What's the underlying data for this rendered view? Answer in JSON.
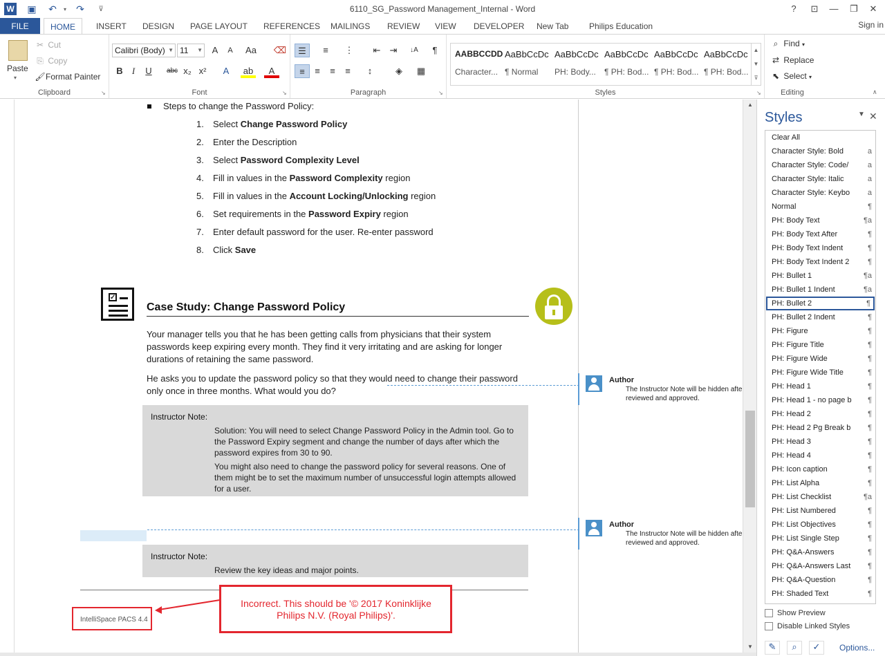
{
  "window": {
    "title": "6110_SG_Password Management_Internal - Word",
    "help": "?",
    "ribbon_opts": "⊡",
    "minimize": "—",
    "restore": "❐",
    "close": "✕"
  },
  "quick_access": {
    "save_icon": "💾",
    "undo": "↶",
    "redo": "↷",
    "customize": "⊽"
  },
  "tabs": [
    {
      "label": "FILE"
    },
    {
      "label": "HOME"
    },
    {
      "label": "INSERT"
    },
    {
      "label": "DESIGN"
    },
    {
      "label": "PAGE LAYOUT"
    },
    {
      "label": "REFERENCES"
    },
    {
      "label": "MAILINGS"
    },
    {
      "label": "REVIEW"
    },
    {
      "label": "VIEW"
    },
    {
      "label": "DEVELOPER"
    },
    {
      "label": "New Tab"
    },
    {
      "label": "Philips Education"
    }
  ],
  "signin": "Sign in",
  "clipboard": {
    "paste": "Paste",
    "cut": "Cut",
    "copy": "Copy",
    "format_painter": "Format Painter",
    "label": "Clipboard"
  },
  "font": {
    "family": "Calibri (Body)",
    "size": "11",
    "grow": "A",
    "shrink": "A",
    "case": "Aa",
    "bold": "B",
    "italic": "I",
    "underline": "U",
    "strike": "abc",
    "subscript": "x₂",
    "superscript": "x²",
    "effects": "A",
    "highlight": "ab",
    "color": "A",
    "label": "Font"
  },
  "paragraph": {
    "label": "Paragraph",
    "pilcrow": "¶",
    "sort": "↓A"
  },
  "styles_gallery": {
    "label": "Styles",
    "tiles": [
      {
        "preview": "AABBCCDD",
        "name": "Character..."
      },
      {
        "preview": "AaBbCcDc",
        "name": "¶ Normal"
      },
      {
        "preview": "AaBbCcDc",
        "name": "PH: Body..."
      },
      {
        "preview": "AaBbCcDc",
        "name": "¶ PH: Bod..."
      },
      {
        "preview": "AaBbCcDc",
        "name": "¶ PH: Bod..."
      },
      {
        "preview": "AaBbCcDc",
        "name": "¶ PH: Bod..."
      }
    ]
  },
  "editing": {
    "find": "Find",
    "replace": "Replace",
    "select": "Select",
    "label": "Editing"
  },
  "document": {
    "bullet_heading": "Steps to change the Password Policy:",
    "steps": [
      {
        "num": "1.",
        "pre": "Select ",
        "bold": "Change Password Policy",
        "post": ""
      },
      {
        "num": "2.",
        "pre": "Enter the Description",
        "bold": "",
        "post": ""
      },
      {
        "num": "3.",
        "pre": "Select ",
        "bold": "Password Complexity Level",
        "post": ""
      },
      {
        "num": "4.",
        "pre": "Fill in values in the ",
        "bold": "Password Complexity",
        "post": " region"
      },
      {
        "num": "5.",
        "pre": "Fill in values in the ",
        "bold": "Account Locking/Unlocking",
        "post": " region"
      },
      {
        "num": "6.",
        "pre": "Set requirements in the ",
        "bold": "Password Expiry",
        "post": " region"
      },
      {
        "num": "7.",
        "pre": "Enter default password for the user. Re-enter password",
        "bold": "",
        "post": ""
      },
      {
        "num": "8.",
        "pre": "Click ",
        "bold": "Save",
        "post": ""
      }
    ],
    "case_study_title": "Case Study: Change Password Policy",
    "para1": "Your manager tells you that he has been getting calls from physicians that their system passwords keep expiring every month. They find it very irritating and are asking for longer durations of retaining the same password.",
    "para2": "He asks you to update the password policy so that they would need to change their password only once in three months. What would you do?",
    "note1_head": "Instructor Note:",
    "note1_text1": "Solution: You will need to select Change Password Policy in the Admin tool. Go to the Password Expiry segment and change the number of days after which the password expires from 30 to 90.",
    "note1_text2": "You might also need to change the password policy for several reasons. One of them might be to set the maximum number of unsuccessful login attempts allowed for a user.",
    "note2_head": "Instructor Note:",
    "note2_text": "Review the key ideas and major points.",
    "footer": "IntelliSpace PACS 4.4",
    "callout": "Incorrect. This should be '© 2017 Koninklijke Philips N.V. (Royal Philips)'."
  },
  "comments": [
    {
      "author": "Author",
      "line1": "The Instructor Note will be hidden after",
      "line2": "reviewed and approved."
    },
    {
      "author": "Author",
      "line1": "The Instructor Note will be hidden after",
      "line2": "reviewed and approved."
    }
  ],
  "styles_pane": {
    "title": "Styles",
    "items": [
      {
        "name": "Clear All",
        "mark": ""
      },
      {
        "name": "Character Style: Bold",
        "mark": "a"
      },
      {
        "name": "Character Style: Code/",
        "mark": "a"
      },
      {
        "name": "Character Style: Italic",
        "mark": "a"
      },
      {
        "name": "Character Style: Keybo",
        "mark": "a"
      },
      {
        "name": "Normal",
        "mark": "¶"
      },
      {
        "name": "PH: Body Text",
        "mark": "¶a"
      },
      {
        "name": "PH: Body Text After",
        "mark": "¶"
      },
      {
        "name": "PH: Body Text Indent",
        "mark": "¶"
      },
      {
        "name": "PH: Body Text Indent 2",
        "mark": "¶"
      },
      {
        "name": "PH: Bullet 1",
        "mark": "¶a"
      },
      {
        "name": "PH: Bullet 1 Indent",
        "mark": "¶a"
      },
      {
        "name": "PH: Bullet 2",
        "mark": "¶"
      },
      {
        "name": "PH: Bullet 2 Indent",
        "mark": "¶"
      },
      {
        "name": "PH: Figure",
        "mark": "¶"
      },
      {
        "name": "PH: Figure Title",
        "mark": "¶"
      },
      {
        "name": "PH: Figure Wide",
        "mark": "¶"
      },
      {
        "name": "PH: Figure Wide Title",
        "mark": "¶"
      },
      {
        "name": "PH: Head 1",
        "mark": "¶"
      },
      {
        "name": "PH: Head 1 - no page b",
        "mark": "¶"
      },
      {
        "name": "PH: Head 2",
        "mark": "¶"
      },
      {
        "name": "PH: Head 2 Pg Break b",
        "mark": "¶"
      },
      {
        "name": "PH: Head 3",
        "mark": "¶"
      },
      {
        "name": "PH: Head 4",
        "mark": "¶"
      },
      {
        "name": "PH: Icon caption",
        "mark": "¶"
      },
      {
        "name": "PH: List Alpha",
        "mark": "¶"
      },
      {
        "name": "PH: List Checklist",
        "mark": "¶a"
      },
      {
        "name": "PH: List Numbered",
        "mark": "¶"
      },
      {
        "name": "PH: List Objectives",
        "mark": "¶"
      },
      {
        "name": "PH: List Single Step",
        "mark": "¶"
      },
      {
        "name": "PH: Q&A-Answers",
        "mark": "¶"
      },
      {
        "name": "PH: Q&A-Answers Last",
        "mark": "¶"
      },
      {
        "name": "PH: Q&A-Question",
        "mark": "¶"
      },
      {
        "name": "PH: Shaded Text",
        "mark": "¶"
      }
    ],
    "selected": "PH: Bullet 2",
    "show_preview": "Show Preview",
    "disable_linked": "Disable Linked Styles",
    "options": "Options..."
  },
  "colors": {
    "accent": "#2b579a",
    "annotation_red": "#e3262e",
    "lock_green": "#b6bf1a",
    "note_grey": "#d9d9d9"
  }
}
